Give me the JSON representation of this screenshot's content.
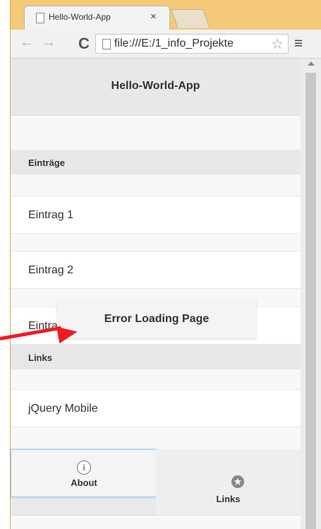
{
  "browser": {
    "tab_title": "Hello-World-App",
    "tab_close": "×",
    "back": "←",
    "forward": "→",
    "reload": "C",
    "url": "file:///E:/1_info_Projekte",
    "bookmark_star": "☆",
    "menu": "≡"
  },
  "page": {
    "header_title": "Hello-World-App",
    "sections": [
      {
        "label": "Einträge",
        "items": [
          "Eintrag 1",
          "Eintrag 2",
          "Eintrag 3"
        ]
      },
      {
        "label": "Links",
        "items": [
          "jQuery Mobile"
        ]
      }
    ],
    "error_popup": "Error Loading Page",
    "footer": {
      "about": "About",
      "links": "Links"
    }
  },
  "icons": {
    "about": "info-icon",
    "links": "star-icon"
  },
  "colors": {
    "tab_strip": "#f4c978",
    "arrow": "#ee1b24",
    "active_outline": "#9fc7ea"
  }
}
